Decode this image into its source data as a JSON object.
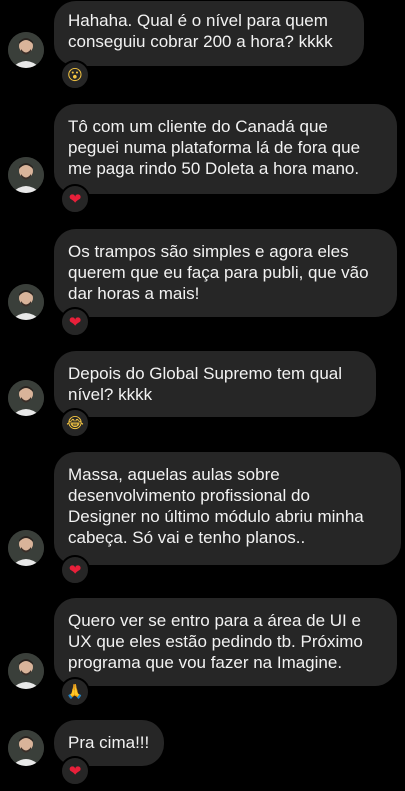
{
  "messages": [
    {
      "text": "Hahaha. Qual é o nível para quem\nconseguiu cobrar 200 a hora? kkkk",
      "reaction": "surprised-emoji",
      "reaction_glyph": "😮"
    },
    {
      "text": "Tô com um cliente do Canadá que\npeguei numa plataforma lá de fora que\nme paga rindo 50 Doleta a hora mano.",
      "reaction": "heart-emoji",
      "reaction_glyph": "❤"
    },
    {
      "text": "Os trampos são simples e agora eles\nquerem que eu faça para publi, que vão\ndar horas a mais!",
      "reaction": "heart-emoji",
      "reaction_glyph": "❤"
    },
    {
      "text": "Depois do Global Supremo tem qual\nnível? kkkk",
      "reaction": "laughing-emoji",
      "reaction_glyph": "😂"
    },
    {
      "text": "Massa, aquelas aulas sobre\ndesenvolvimento profissional do\nDesigner no último módulo abriu minha\ncabeça. Só vai e tenho planos..",
      "reaction": "heart-emoji",
      "reaction_glyph": "❤"
    },
    {
      "text": "Quero ver se entro para a área de UI e\nUX que eles estão pedindo tb. Próximo\nprograma que vou fazer na Imagine.",
      "reaction": "praying-hands-emoji",
      "reaction_glyph": "🙏"
    },
    {
      "text": "Pra cima!!!",
      "reaction": "heart-emoji",
      "reaction_glyph": "❤"
    }
  ],
  "colors": {
    "background": "#000000",
    "bubble": "#262626",
    "text": "#f2f2f2",
    "heart": "#e8203a"
  }
}
